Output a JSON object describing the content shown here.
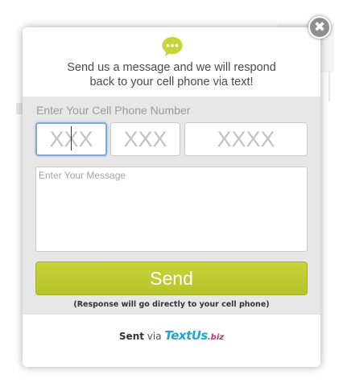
{
  "close_button": {
    "label": "✖"
  },
  "header": {
    "icon": "chat-bubble-icon",
    "icon_color": "#c6d43a",
    "message": "Send us a message and we will respond\nback to your cell phone via text!"
  },
  "phone": {
    "label": "Enter Your Cell Phone Number",
    "area_code_placeholder": "XXX",
    "prefix_placeholder": "XXX",
    "line_number_placeholder": "XXXX"
  },
  "message": {
    "placeholder": "Enter Your Message"
  },
  "send_button": {
    "label": "Send",
    "color": "#c0cf34"
  },
  "note": "(Response will go directly to your cell phone)",
  "footer": {
    "sent_label": "Sent",
    "via_label": "via",
    "brand_name": "TextUs",
    "brand_tld": ".biz",
    "brand_color": "#1ea6d6",
    "tld_color": "#c0307c"
  }
}
